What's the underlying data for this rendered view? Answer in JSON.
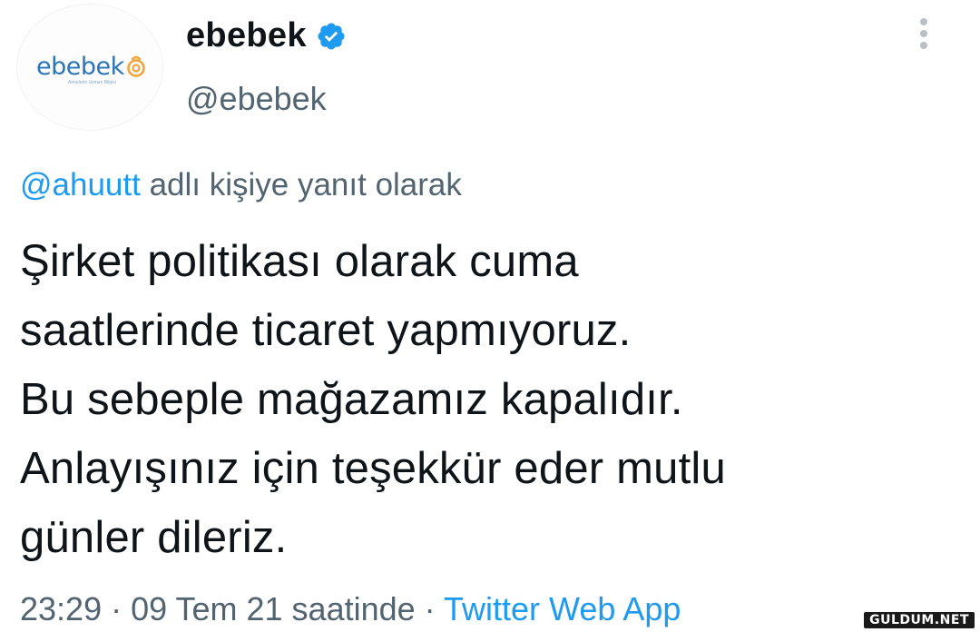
{
  "author": {
    "display_name": "ebebek",
    "handle": "@ebebek",
    "verified": true,
    "avatar_logo_text": "ebebek",
    "avatar_tagline": "Annelerin Uzman Bilgisi"
  },
  "reply_context": {
    "mention": "@ahuutt",
    "text": " adlı kişiye yanıt olarak"
  },
  "tweet": {
    "text": "Şirket politikası olarak cuma\nsaatlerinde ticaret yapmıyoruz.\nBu sebeple mağazamız kapalıdır.\nAnlayışınız için teşekkür eder mutlu\ngünler dileriz."
  },
  "meta": {
    "time": "23:29",
    "separator1": " · ",
    "date": "09 Tem 21 saatinde",
    "separator2": " · ",
    "source": "Twitter Web App"
  },
  "watermark": "GULDUM.NET",
  "colors": {
    "accent": "#1d9bf0",
    "muted": "#536471",
    "text": "#0f1419",
    "logo_blue": "#2c74b8",
    "logo_orange": "#f2a43a"
  },
  "icons": {
    "verified": "verified-badge-icon",
    "more": "more-options-icon"
  }
}
